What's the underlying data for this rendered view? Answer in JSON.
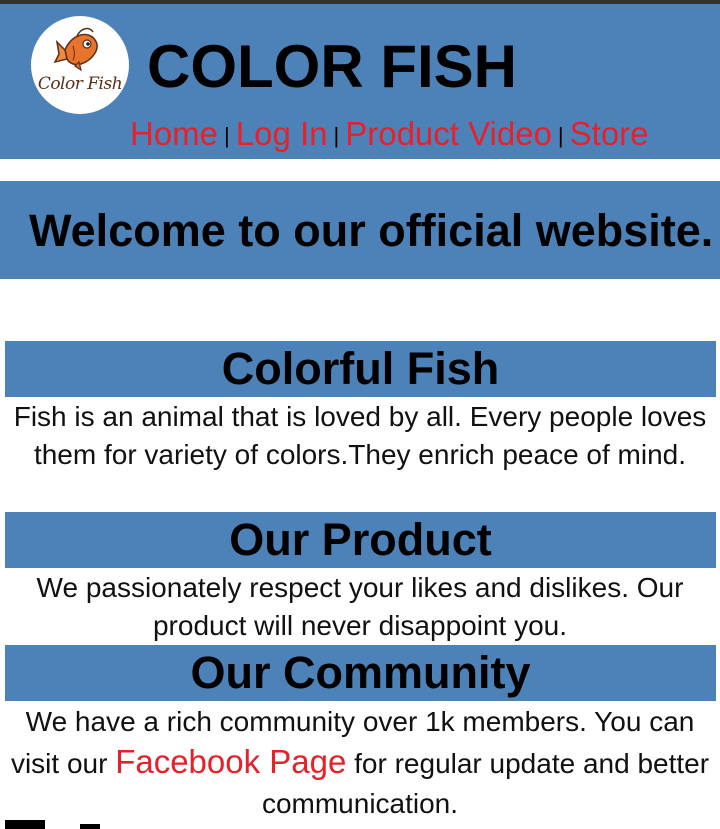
{
  "header": {
    "logo_text": "Color Fish",
    "site_title": "COLOR FISH",
    "nav": [
      {
        "label": "Home"
      },
      {
        "label": "Log In"
      },
      {
        "label": "Product Video"
      },
      {
        "label": "Store"
      }
    ],
    "separator": "|"
  },
  "welcome": {
    "heading": "Welcome to our official website."
  },
  "sections": [
    {
      "title": "Colorful Fish",
      "text": "Fish is an animal that is loved by all. Every people loves them for variety of colors.They enrich peace of mind."
    },
    {
      "title": "Our Product",
      "text": "We passionately respect your likes and dislikes. Our product will never disappoint you."
    },
    {
      "title": "Our Community",
      "text_before": "We have a rich community over 1k members. You can visit our",
      "link_label": "Facebook Page",
      "text_after": "for regular update and better communication."
    }
  ],
  "colors": {
    "band_blue": "#4d82b8",
    "link_red": "#e8202a",
    "fish_orange": "#e8732a"
  },
  "icons": {
    "logo": "fish-icon"
  }
}
